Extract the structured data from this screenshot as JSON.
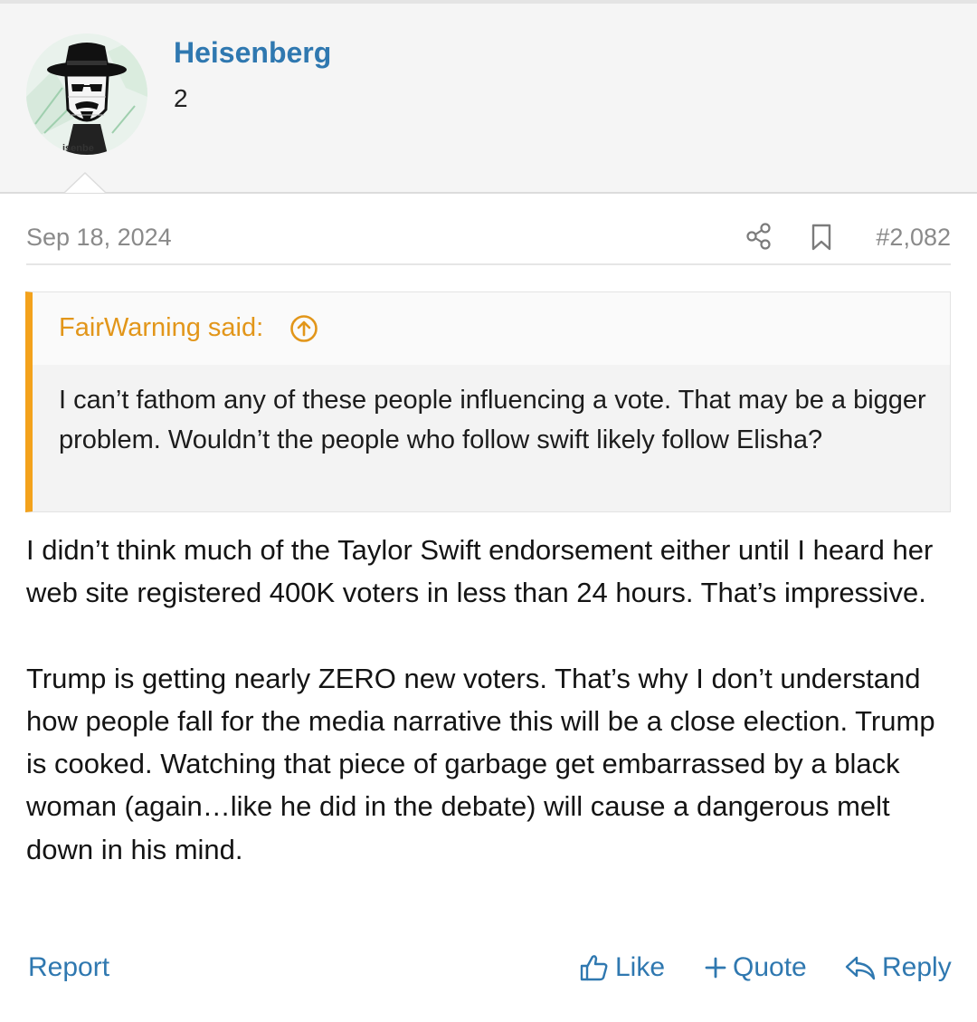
{
  "user": {
    "name": "Heisenberg",
    "count": "2",
    "avatar_icon": "heisenberg-avatar-icon"
  },
  "post": {
    "date": "Sep 18, 2024",
    "number": "#2,082",
    "share_icon": "share-icon",
    "bookmark_icon": "bookmark-icon",
    "quote": {
      "author_label": "FairWarning said:",
      "jump_icon": "arrow-up-circle-icon",
      "text": "I can’t fathom any of these people influencing a vote. That may be a bigger problem. Wouldn’t the people who follow swift likely follow Elisha?"
    },
    "paragraphs": [
      "I didn’t think much of the Taylor Swift endorsement either until I heard her web site registered 400K voters in less than 24 hours. That’s impressive.",
      "Trump is getting nearly ZERO new voters. That’s why I don’t understand how people fall for the media narrative this will be a close election. Trump is cooked. Watching that piece of garbage get embarrassed by a black woman (again…like he did in the debate) will cause a dangerous melt down in his mind."
    ]
  },
  "actions": {
    "report": "Report",
    "like": "Like",
    "quote": "Quote",
    "reply": "Reply"
  },
  "colors": {
    "link": "#2f78b0",
    "quote_accent": "#f3a21c",
    "meta": "#8a8a8a"
  }
}
